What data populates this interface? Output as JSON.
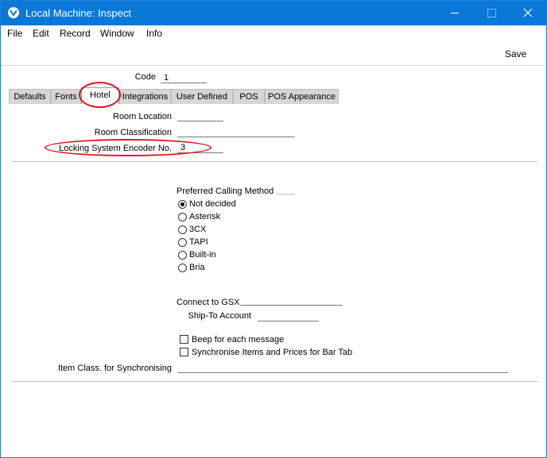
{
  "window": {
    "title": "Local Machine: Inspect"
  },
  "menu": {
    "items": [
      "File",
      "Edit",
      "Record",
      "Window",
      "Info"
    ]
  },
  "toolbar": {
    "save_label": "Save"
  },
  "form": {
    "code_label": "Code",
    "code_value": "1",
    "tabs": [
      "Defaults",
      "Fonts",
      "Hotel",
      "Integrations",
      "User Defined",
      "POS",
      "POS Appearance"
    ],
    "active_tab": "Hotel",
    "room_location_label": "Room Location",
    "room_location_value": "",
    "room_classification_label": "Room Classification",
    "room_classification_value": "",
    "locking_label": "Locking System Encoder No.",
    "locking_value": "3",
    "calling_method_label": "Preferred Calling Method",
    "calling_methods": [
      "Not decided",
      "Asterisk",
      "3CX",
      "TAPI",
      "Built-in",
      "Bria"
    ],
    "calling_method_selected": "Not decided",
    "connect_gsx_label": "Connect to GSX",
    "connect_gsx_value": "",
    "ship_to_label": "Ship-To Account",
    "ship_to_value": "",
    "beep_label": "Beep for each message",
    "beep_checked": false,
    "sync_label": "Synchronise Items and Prices for Bar Tab",
    "sync_checked": false,
    "item_class_label": "Item Class. for Synchronising",
    "item_class_value": ""
  },
  "colors": {
    "titlebar": "#0a78d7",
    "highlight": "#e0141b"
  }
}
